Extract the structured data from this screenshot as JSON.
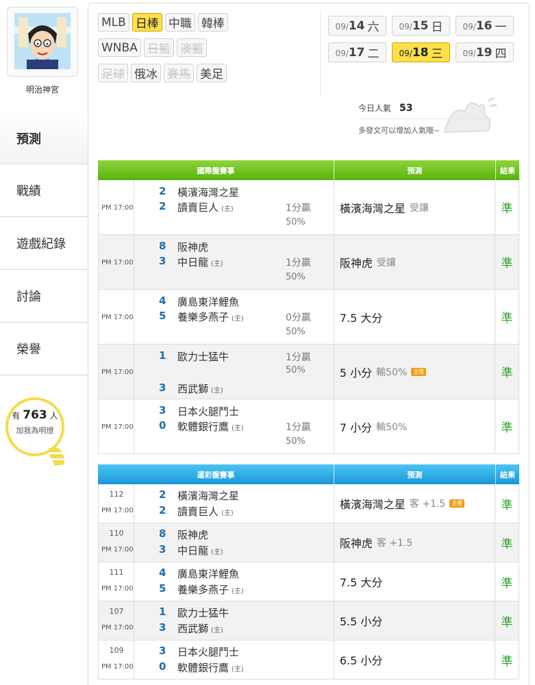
{
  "sidebar": {
    "username": "明治神宮",
    "nav": [
      {
        "label": "預測",
        "active": true
      },
      {
        "label": "戰績",
        "active": false
      },
      {
        "label": "遊戲紀錄",
        "active": false
      },
      {
        "label": "討論",
        "active": false
      },
      {
        "label": "榮譽",
        "active": false
      }
    ],
    "bulb": {
      "prefix": "有",
      "count": "763",
      "suffix": "人",
      "caption": "加我為明燈"
    }
  },
  "categories": {
    "row1": [
      {
        "label": "MLB"
      },
      {
        "label": "日棒",
        "active": true
      },
      {
        "label": "中職"
      },
      {
        "label": "韓棒"
      }
    ],
    "row2": [
      {
        "label": "WNBA"
      },
      {
        "label": "日籃",
        "disabled": true
      },
      {
        "label": "澳籃",
        "disabled": true
      }
    ],
    "row3": [
      {
        "label": "足球",
        "disabled": true
      },
      {
        "label": "俄冰"
      },
      {
        "label": "賽馬",
        "disabled": true
      },
      {
        "label": "美足"
      }
    ]
  },
  "dates": {
    "row1": [
      {
        "prefix": "09/",
        "day": "14",
        "weekday": "六"
      },
      {
        "prefix": "09/",
        "day": "15",
        "weekday": "日"
      },
      {
        "prefix": "09/",
        "day": "16",
        "weekday": "一"
      }
    ],
    "row2": [
      {
        "prefix": "09/",
        "day": "17",
        "weekday": "二"
      },
      {
        "prefix": "09/",
        "day": "18",
        "weekday": "三",
        "active": true
      },
      {
        "prefix": "09/",
        "day": "19",
        "weekday": "四"
      }
    ]
  },
  "popularity": {
    "label": "今日人氣",
    "count": "53",
    "hint": "多發文可以增加人氣哦~"
  },
  "intl_table": {
    "header": {
      "events": "國際盤賽事",
      "prediction": "預測",
      "result": "結果"
    },
    "rows": [
      {
        "time": "PM 17:00",
        "s1": "2",
        "t1": "橫濱海灣之星",
        "s2": "2",
        "t2": "讀賣巨人",
        "home": "(主)",
        "w1": "1分贏",
        "w2": "50%",
        "pred": "橫濱海灣之星",
        "pred_sub": "受讓",
        "badge": "",
        "result": "準",
        "layout": "a"
      },
      {
        "time": "PM 17:00",
        "s1": "8",
        "t1": "阪神虎",
        "s2": "3",
        "t2": "中日龍",
        "home": "(主)",
        "w1": "1分贏",
        "w2": "50%",
        "pred": "阪神虎",
        "pred_sub": "受讓",
        "badge": "",
        "result": "準",
        "layout": "a"
      },
      {
        "time": "PM 17:00",
        "s1": "4",
        "t1": "廣島東洋鯉魚",
        "s2": "5",
        "t2": "養樂多燕子",
        "home": "(主)",
        "w1": "0分贏",
        "w2": "50%",
        "pred": "7.5 大分",
        "pred_sub": "",
        "badge": "",
        "result": "準",
        "layout": "a"
      },
      {
        "time": "PM 17:00",
        "s1": "1",
        "t1": "歐力士猛牛",
        "s2": "3",
        "t2": "西武獅",
        "home": "(主)",
        "w1": "1分贏",
        "w2": "50%",
        "pred": "5 小分",
        "pred_sub": "輸50%",
        "badge": "主推",
        "result": "準",
        "layout": "b"
      },
      {
        "time": "PM 17:00",
        "s1": "3",
        "t1": "日本火腿鬥士",
        "s2": "0",
        "t2": "軟體銀行鷹",
        "home": "(主)",
        "w1": "1分贏",
        "w2": "50%",
        "pred": "7 小分",
        "pred_sub": "輸50%",
        "badge": "",
        "result": "準",
        "layout": "a"
      }
    ]
  },
  "lottery_table": {
    "header": {
      "events": "運彩盤賽事",
      "prediction": "預測",
      "result": "結果"
    },
    "rows": [
      {
        "code": "112",
        "time": "PM 17:00",
        "s1": "2",
        "t1": "橫濱海灣之星",
        "s2": "2",
        "t2": "讀賣巨人",
        "home": "(主)",
        "pred": "橫濱海灣之星",
        "pred_sub": "客 +1.5",
        "badge": "主推",
        "result": "準"
      },
      {
        "code": "110",
        "time": "PM 17:00",
        "s1": "8",
        "t1": "阪神虎",
        "s2": "3",
        "t2": "中日龍",
        "home": "(主)",
        "pred": "阪神虎",
        "pred_sub": "客 +1.5",
        "badge": "",
        "result": "準"
      },
      {
        "code": "111",
        "time": "PM 17:00",
        "s1": "4",
        "t1": "廣島東洋鯉魚",
        "s2": "5",
        "t2": "養樂多燕子",
        "home": "(主)",
        "pred": "7.5 大分",
        "pred_sub": "",
        "badge": "",
        "result": "準"
      },
      {
        "code": "107",
        "time": "PM 17:00",
        "s1": "1",
        "t1": "歐力士猛牛",
        "s2": "3",
        "t2": "西武獅",
        "home": "(主)",
        "pred": "5.5 小分",
        "pred_sub": "",
        "badge": "",
        "result": "準"
      },
      {
        "code": "109",
        "time": "PM 17:00",
        "s1": "3",
        "t1": "日本火腿鬥士",
        "s2": "0",
        "t2": "軟體銀行鷹",
        "home": "(主)",
        "pred": "6.5 小分",
        "pred_sub": "",
        "badge": "",
        "result": "準"
      }
    ]
  },
  "colors": {
    "active_yellow": "#ffe04a",
    "intl_header": "#6cc21f",
    "lottery_header": "#27a7e4",
    "result_green": "#2aa32a",
    "score_blue": "#1a6fb0"
  }
}
